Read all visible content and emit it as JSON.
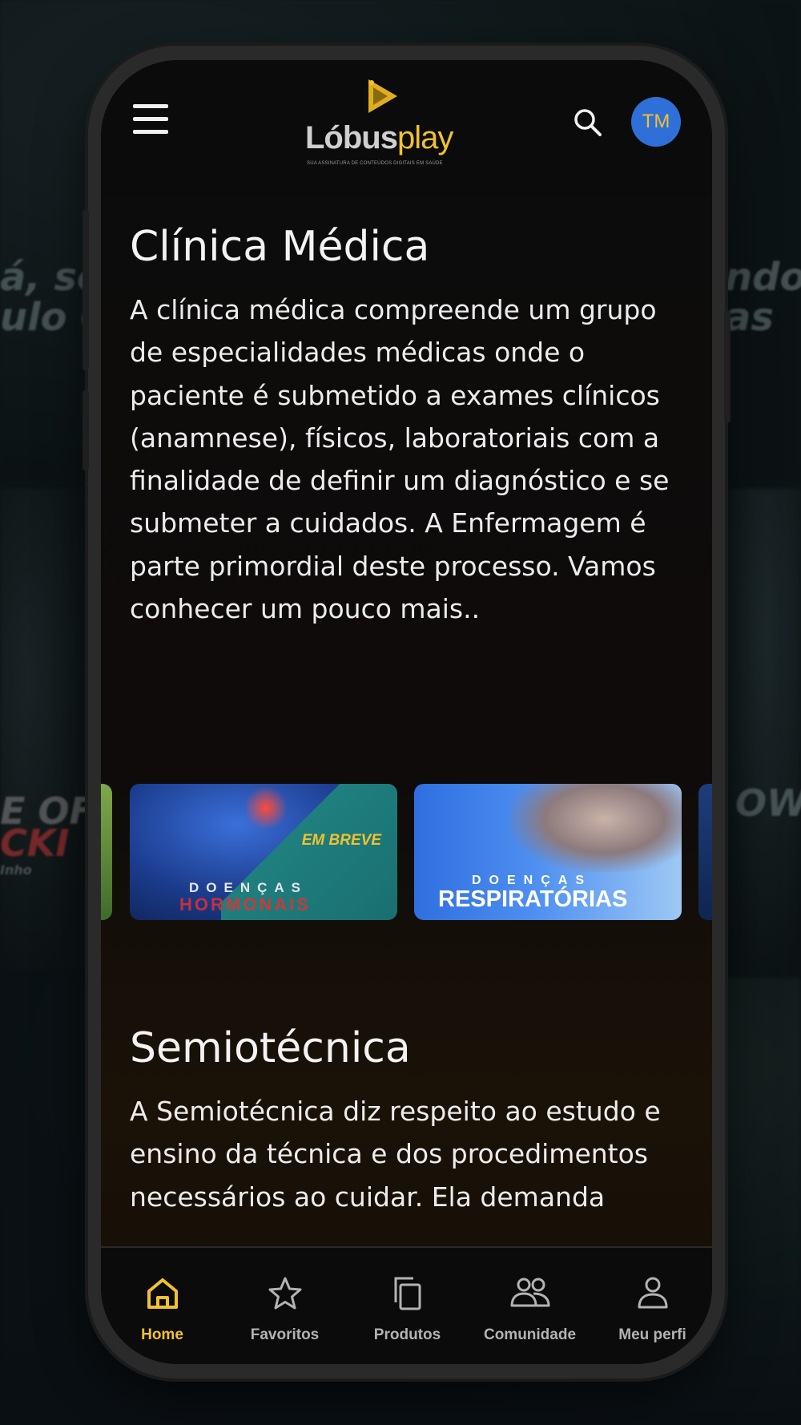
{
  "background": {
    "text_left_1": "á, sou",
    "text_left_2": "ulo Co",
    "text_right_1": "ndo",
    "text_right_2": "as",
    "text_left_3": "E OF",
    "text_left_4": "CKI",
    "text_left_5": "Inho",
    "text_right_3": "OW"
  },
  "header": {
    "logo_text_part1": "Lóbus",
    "logo_text_part2": "play",
    "logo_tagline": "SUA ASSINATURA DE CONTEÚDOS DIGITAIS EM SAÚDE",
    "avatar_initials": "TM",
    "menu_icon": "hamburger-icon",
    "search_icon": "search-icon"
  },
  "sections": [
    {
      "title": "Clínica Médica",
      "description": "A clínica médica compreende um grupo de especialidades médicas onde o paciente é submetido a exames clínicos (anamnese), físicos, laboratoriais com a finalidade de definir um diagnóstico e se submeter a cuidados. A Enfermagem é parte primordial deste processo. Vamos conhecer um pouco mais.."
    },
    {
      "title": "Semiotécnica",
      "description": "A Semiotécnica diz respeito ao estudo e ensino da técnica e dos procedimentos necessários ao cuidar. Ela demanda"
    }
  ],
  "carousel": [
    {
      "badge": "EM BREVE",
      "line1": "DOENÇAS",
      "line2": "HORMONAIS"
    },
    {
      "line1": "DOENÇAS",
      "line2": "RESPIRATÓRIAS"
    }
  ],
  "bottom_nav": [
    {
      "label": "Home",
      "icon": "home-icon",
      "active": true
    },
    {
      "label": "Favoritos",
      "icon": "star-icon",
      "active": false
    },
    {
      "label": "Produtos",
      "icon": "copy-icon",
      "active": false
    },
    {
      "label": "Comunidade",
      "icon": "users-icon",
      "active": false
    },
    {
      "label": "Meu perfi",
      "icon": "user-icon",
      "active": false
    }
  ],
  "colors": {
    "accent": "#f2c12e",
    "avatar_bg": "#2f6fd8",
    "nav_inactive": "#b3b3b3"
  }
}
